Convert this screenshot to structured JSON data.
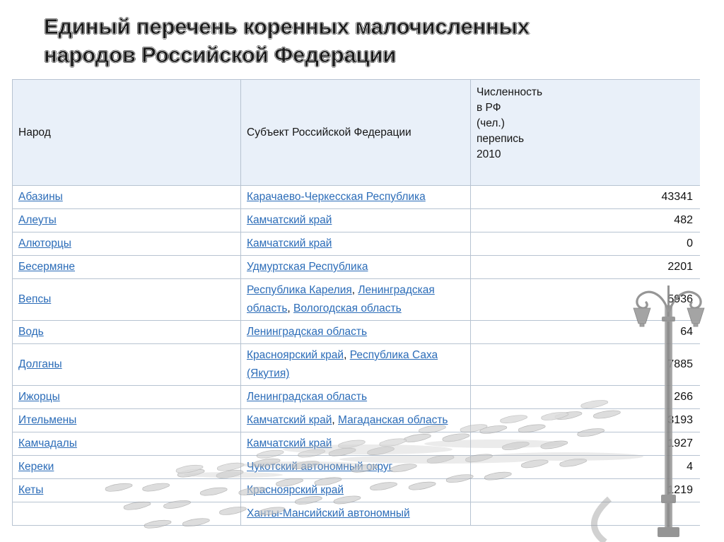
{
  "slide": {
    "title": "Единый перечень коренных малочисленных\nнародов Российской Федерации",
    "background_color": "#ffffff",
    "link_color": "#2b6cb8",
    "header_fill": "#e9f0f9",
    "border_color": "#b7c3d1"
  },
  "table": {
    "headers": {
      "people": "Народ",
      "subject": "Субъект Российской Федерации",
      "count": "Численность\nв РФ\n(чел.)\nперепись\n2010"
    },
    "rows": [
      {
        "people": "Абазины",
        "subjects": [
          "Карачаево-Черкесская Республика"
        ],
        "count": "43341"
      },
      {
        "people": "Алеуты",
        "subjects": [
          "Камчатский край"
        ],
        "count": "482"
      },
      {
        "people": "Алюторцы",
        "subjects": [
          "Камчатский край"
        ],
        "count": "0"
      },
      {
        "people": "Бесермяне",
        "subjects": [
          "Удмуртская Республика"
        ],
        "count": "2201"
      },
      {
        "people": "Вепсы",
        "subjects": [
          "Республика Карелия",
          "Ленинградская область",
          "Вологодская область"
        ],
        "count": "5936"
      },
      {
        "people": "Водь",
        "subjects": [
          "Ленинградская область"
        ],
        "count": "64"
      },
      {
        "people": "Долганы",
        "subjects": [
          "Красноярский край",
          "Республика Саха (Якутия)"
        ],
        "count": "7885"
      },
      {
        "people": "Ижорцы",
        "subjects": [
          "Ленинградская область"
        ],
        "count": "266"
      },
      {
        "people": "Ительмены",
        "subjects": [
          "Камчатский край",
          "Магаданская область"
        ],
        "count": "3193"
      },
      {
        "people": "Камчадалы",
        "subjects": [
          "Камчатский край"
        ],
        "count": "1927"
      },
      {
        "people": "Кереки",
        "subjects": [
          "Чукотский автономный округ"
        ],
        "count": "4"
      },
      {
        "people": "Кеты",
        "subjects": [
          "Красноярский край"
        ],
        "count": "1219"
      },
      {
        "people": "",
        "subjects": [
          "Ханты-Мансийский автономный"
        ],
        "count": ""
      }
    ]
  },
  "watermark": {
    "lamppost_icon": "street-lamp-icon",
    "pavement_icon": "cobblestone-pavement-icon",
    "color": "#9a9a9a"
  }
}
